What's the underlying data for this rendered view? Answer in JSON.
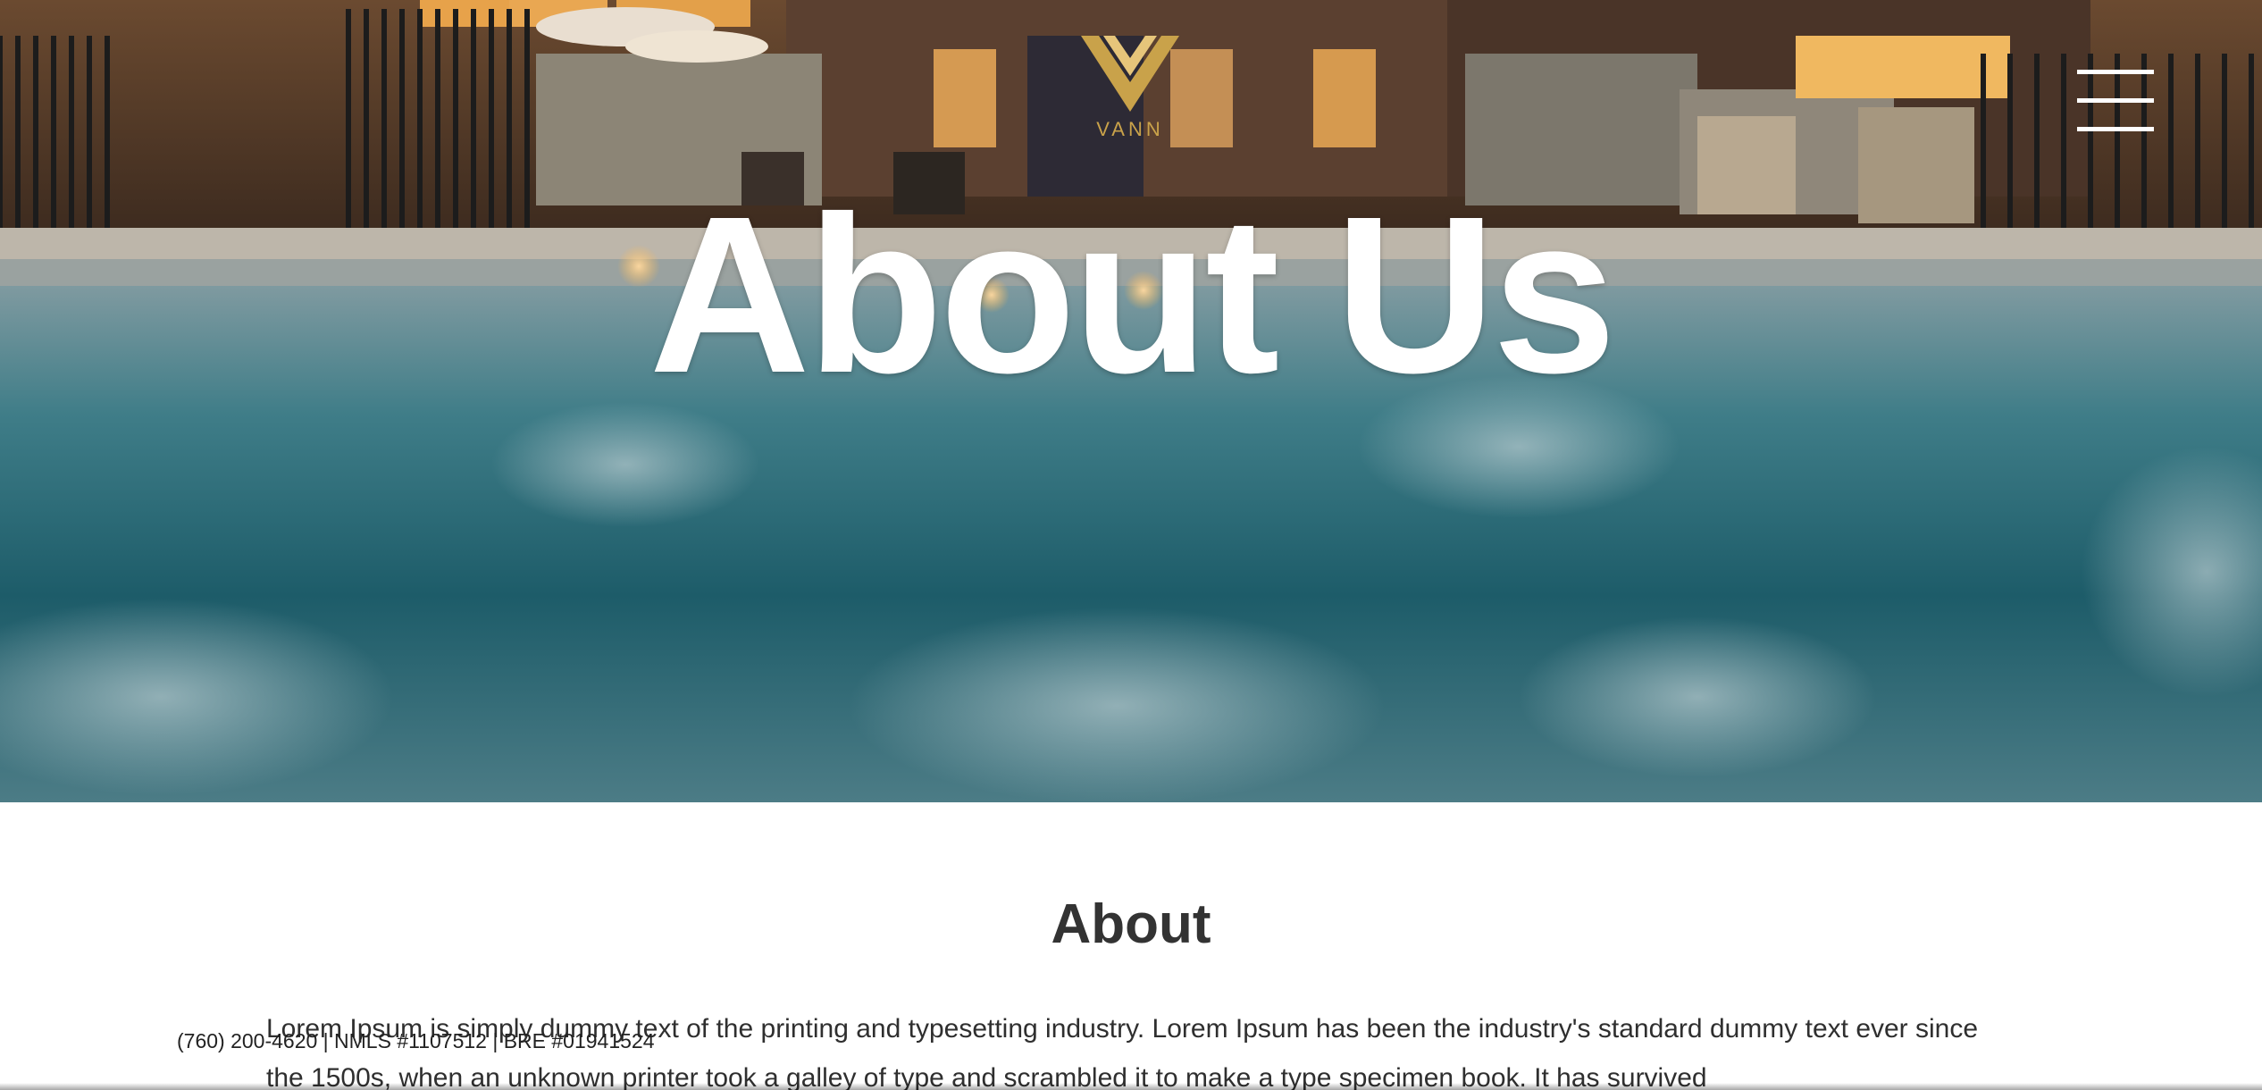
{
  "brand": {
    "logo_text": "VANN"
  },
  "hero": {
    "title": "About Us"
  },
  "nav": {
    "menu_icon": "hamburger-menu-icon"
  },
  "about": {
    "heading": "About",
    "body": "Lorem Ipsum is simply dummy text of the printing and typesetting industry. Lorem Ipsum has been the industry's standard dummy text ever since the 1500s, when an unknown printer took a galley of type and scrambled it to make a type specimen book. It has survived"
  },
  "footer": {
    "contact": "(760) 200-4620 | NMLS #1107512 | BRE #01941524"
  },
  "colors": {
    "logo_gold": "#c9a24a",
    "heading": "#333333",
    "text": "#2f2f2f",
    "pool_teal": "#1f5d6a"
  }
}
